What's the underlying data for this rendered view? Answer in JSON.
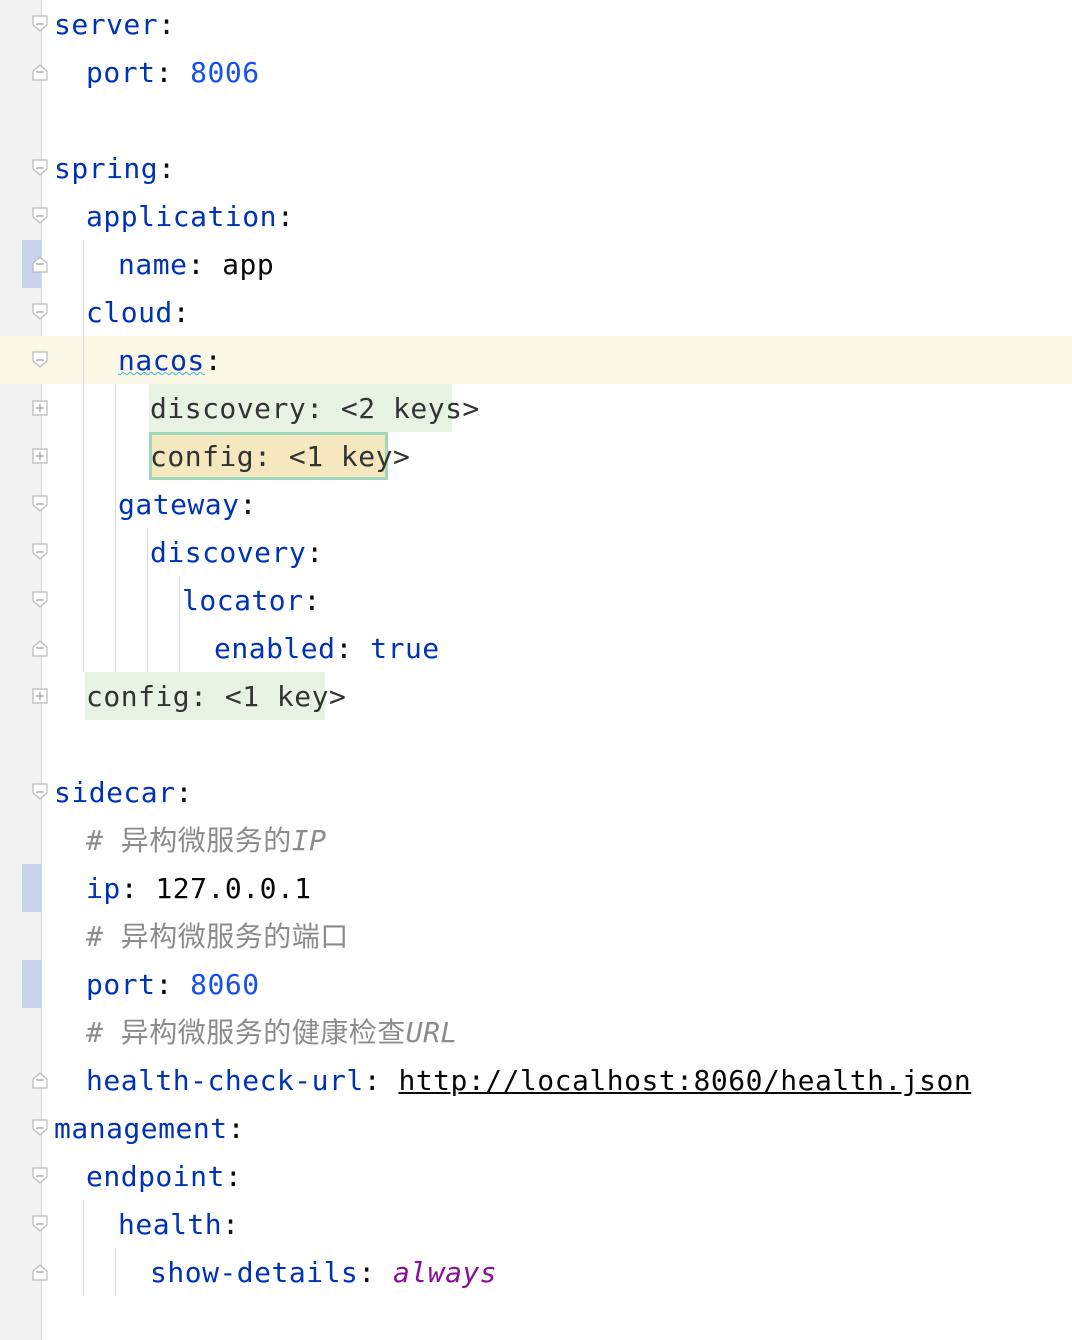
{
  "colors": {
    "key": "#0033b3",
    "number": "#1750eb",
    "keyword": "#0033b3",
    "enum_value": "#871094",
    "comment": "#8c8c8c",
    "plain": "#080808",
    "gutter_bg": "#f2f2f2",
    "caret_row_bg": "#fbf8e6",
    "folded_bg": "#e7f4e4",
    "folded_selected_bg": "#f6e8be",
    "folded_selected_border": "#9fd8bb",
    "changed_marker": "#c6d5ea"
  },
  "lines": [
    {
      "key": "server",
      "sep": ":",
      "fold": "fold-open-icon"
    },
    {
      "key": "port",
      "sep": ": ",
      "value": "8006",
      "fold": "fold-close-icon"
    },
    {},
    {
      "key": "spring",
      "sep": ":",
      "fold": "fold-open-icon"
    },
    {
      "key": "application",
      "sep": ":",
      "fold": "fold-open-icon"
    },
    {
      "key": "name",
      "sep": ": ",
      "value": "app",
      "fold": "fold-close-icon",
      "changed": true
    },
    {
      "key": "cloud",
      "sep": ":",
      "fold": "fold-open-icon"
    },
    {
      "key": "nacos",
      "sep": ":",
      "fold": "fold-open-icon",
      "caret_row": true
    },
    {
      "folded_text": "discovery: <2 keys>",
      "fold": "fold-expand-icon"
    },
    {
      "folded_text": "config: <1 key>",
      "fold": "fold-expand-icon",
      "selected": true
    },
    {
      "key": "gateway",
      "sep": ":",
      "fold": "fold-open-icon"
    },
    {
      "key": "discovery",
      "sep": ":",
      "fold": "fold-open-icon"
    },
    {
      "key": "locator",
      "sep": ":",
      "fold": "fold-open-icon"
    },
    {
      "key": "enabled",
      "sep": ": ",
      "value": "true",
      "fold": "fold-close-icon"
    },
    {
      "folded_text": "config: <1 key>",
      "fold": "fold-expand-icon"
    },
    {},
    {
      "key": "sidecar",
      "sep": ":",
      "fold": "fold-open-icon"
    },
    {
      "comment_plain": "# 异构微服务的",
      "comment_italic": "IP"
    },
    {
      "key": "ip",
      "sep": ": ",
      "value": "127.0.0.1",
      "changed": true
    },
    {
      "comment_plain": "# 异构微服务的端口",
      "comment_italic": ""
    },
    {
      "key": "port",
      "sep": ": ",
      "value": "8060",
      "changed": true
    },
    {
      "comment_plain": "# 异构微服务的健康检查",
      "comment_italic": "URL"
    },
    {
      "key": "health-check-url",
      "sep": ": ",
      "value": "http://localhost:8060/health.json",
      "fold": "fold-close-icon"
    },
    {
      "key": "management",
      "sep": ":",
      "fold": "fold-open-icon"
    },
    {
      "key": "endpoint",
      "sep": ":",
      "fold": "fold-open-icon"
    },
    {
      "key": "health",
      "sep": ":",
      "fold": "fold-open-icon"
    },
    {
      "key": "show-details",
      "sep": ": ",
      "value": "always",
      "fold": "fold-close-icon"
    }
  ]
}
